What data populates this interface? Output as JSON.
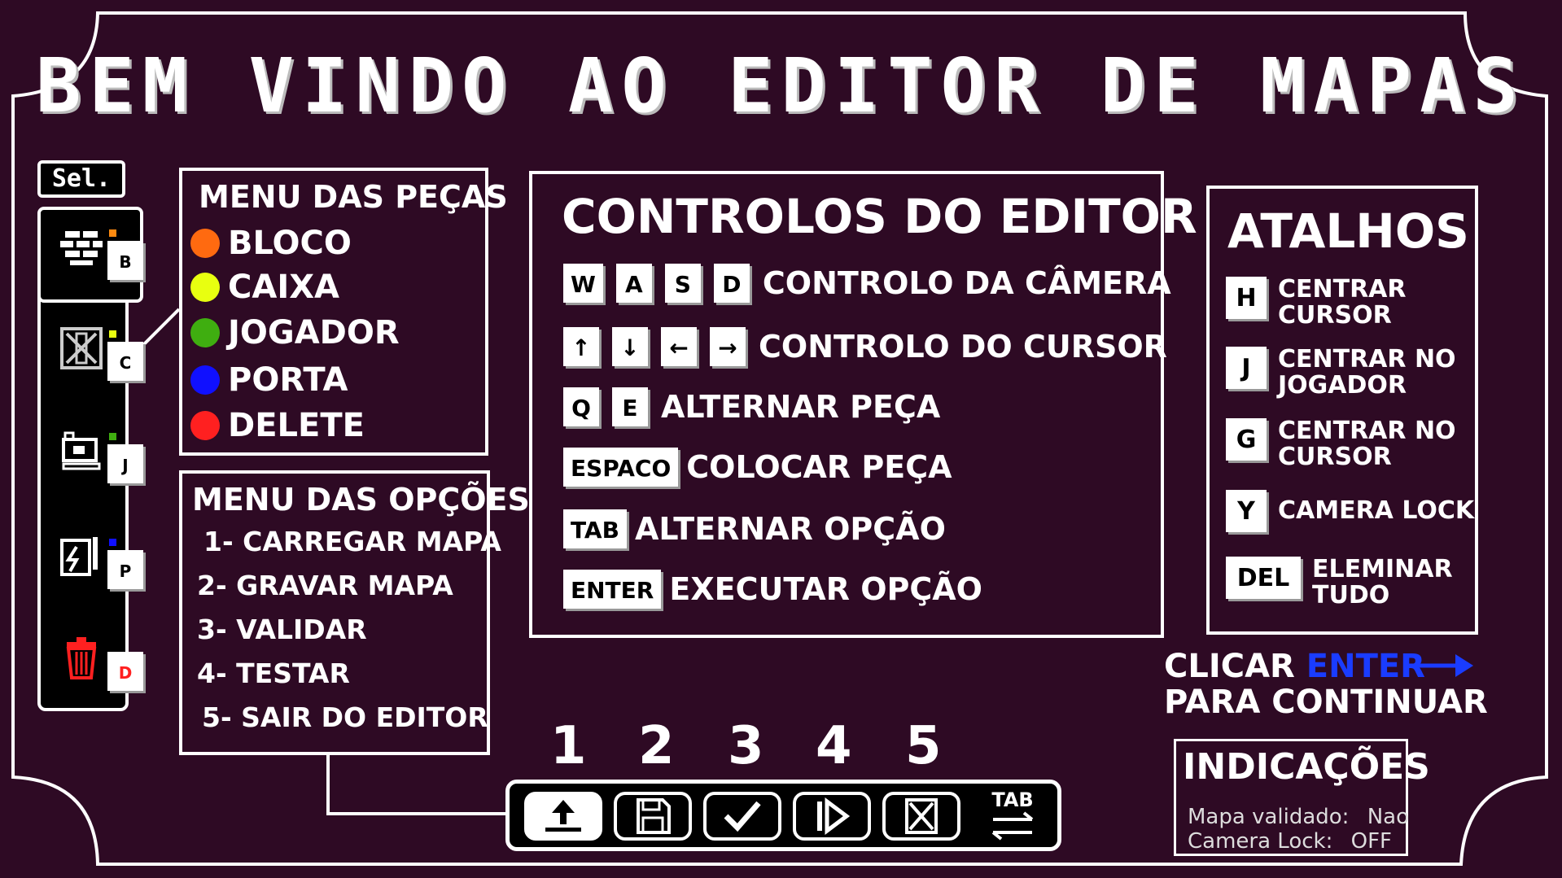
{
  "title": "BEM VINDO AO EDITOR DE MAPAS",
  "colors": {
    "background": "#2e0a24",
    "accent_blue": "#1a3cff",
    "orange": "#ff6a10",
    "yellow": "#e8ff10",
    "green": "#3fae10",
    "blue": "#1010ff",
    "red": "#ff2020"
  },
  "selector": {
    "tag": "Sel.",
    "items": [
      {
        "icon": "brick-icon",
        "key": "B",
        "color": "#ff8a10"
      },
      {
        "icon": "crate-icon",
        "key": "C",
        "color": "#e8ff10"
      },
      {
        "icon": "player-icon",
        "key": "J",
        "color": "#3fae10"
      },
      {
        "icon": "door-icon",
        "key": "P",
        "color": "#1010ff"
      },
      {
        "icon": "trash-icon",
        "key": "D",
        "color": "#ff2020"
      }
    ]
  },
  "pieces_menu": {
    "title": "MENU DAS PEÇAS",
    "items": [
      {
        "label": "BLOCO",
        "color": "#ff6a10"
      },
      {
        "label": "CAIXA",
        "color": "#e8ff10"
      },
      {
        "label": "JOGADOR",
        "color": "#3fae10"
      },
      {
        "label": "PORTA",
        "color": "#1010ff"
      },
      {
        "label": "DELETE",
        "color": "#ff2020"
      }
    ]
  },
  "options_menu": {
    "title": "MENU DAS OPÇÕES",
    "items": [
      "1- CARREGAR MAPA",
      "2- GRAVAR MAPA",
      "3- VALIDAR",
      "4- TESTAR",
      "5- SAIR DO EDITOR"
    ]
  },
  "controls": {
    "title": "CONTROLOS DO EDITOR",
    "rows": [
      {
        "keys": [
          "W",
          "A",
          "S",
          "D"
        ],
        "label": "CONTROLO DA CÂMERA"
      },
      {
        "keys": [
          "↑",
          "↓",
          "←",
          "→"
        ],
        "label": "CONTROLO DO CURSOR"
      },
      {
        "keys": [
          "Q",
          "E"
        ],
        "label": "ALTERNAR PEÇA"
      },
      {
        "keys": [
          "ESPACO"
        ],
        "label": "COLOCAR PEÇA"
      },
      {
        "keys": [
          "TAB"
        ],
        "label": "ALTERNAR OPÇÃO"
      },
      {
        "keys": [
          "ENTER"
        ],
        "label": "EXECUTAR OPÇÃO"
      }
    ]
  },
  "shortcuts": {
    "title": "ATALHOS",
    "rows": [
      {
        "key": "H",
        "label": "CENTRAR\nCURSOR"
      },
      {
        "key": "J",
        "label": "CENTRAR NO\nJOGADOR"
      },
      {
        "key": "G",
        "label": "CENTRAR NO\nCURSOR"
      },
      {
        "key": "Y",
        "label": "CAMERA LOCK"
      },
      {
        "key": "DEL",
        "label": "ELEMINAR\nTUDO"
      }
    ]
  },
  "continue_prompt": {
    "line1_prefix": "CLICAR ",
    "line1_key": "ENTER",
    "line2": "PARA CONTINUAR"
  },
  "indicators": {
    "title": "INDICAÇÕES",
    "map_validated_label": "Mapa validado:",
    "map_validated_value": "Nao",
    "camera_lock_label": "Camera Lock:",
    "camera_lock_value": "OFF"
  },
  "toolbar": {
    "numbers": [
      "1",
      "2",
      "3",
      "4",
      "5"
    ],
    "buttons": [
      {
        "icon": "upload-icon"
      },
      {
        "icon": "save-icon"
      },
      {
        "icon": "check-icon"
      },
      {
        "icon": "play-icon"
      },
      {
        "icon": "exit-icon"
      }
    ],
    "tab_label": "TAB"
  }
}
